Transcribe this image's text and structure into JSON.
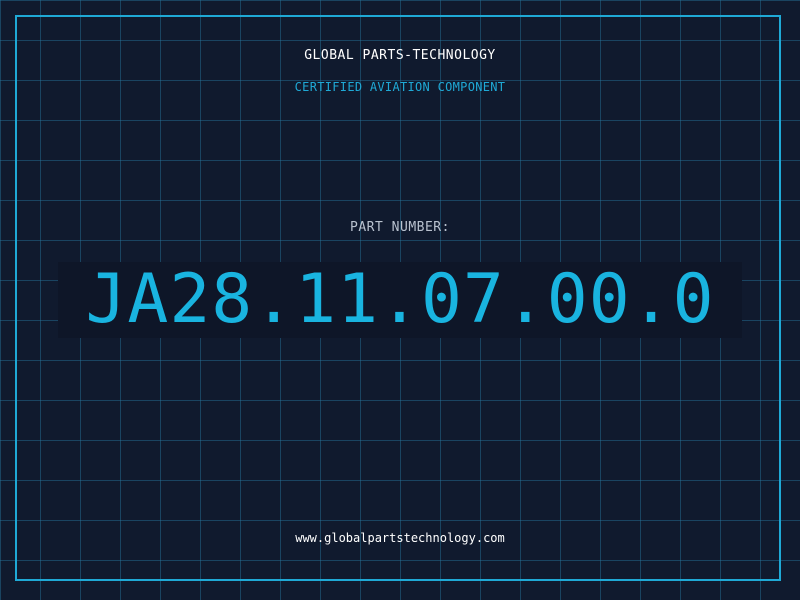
{
  "header": {
    "company": "GLOBAL PARTS-TECHNOLOGY",
    "subtitle": "CERTIFIED AVIATION COMPONENT"
  },
  "part": {
    "label": "PART NUMBER:",
    "number": "JA28.11.07.00.0"
  },
  "footer": {
    "url": "www.globalpartstechnology.com"
  },
  "colors": {
    "background": "#101a2e",
    "grid": "#26789f",
    "accent": "#1fa9d6",
    "text": "#ffffff",
    "muted": "#b9c2cf"
  }
}
